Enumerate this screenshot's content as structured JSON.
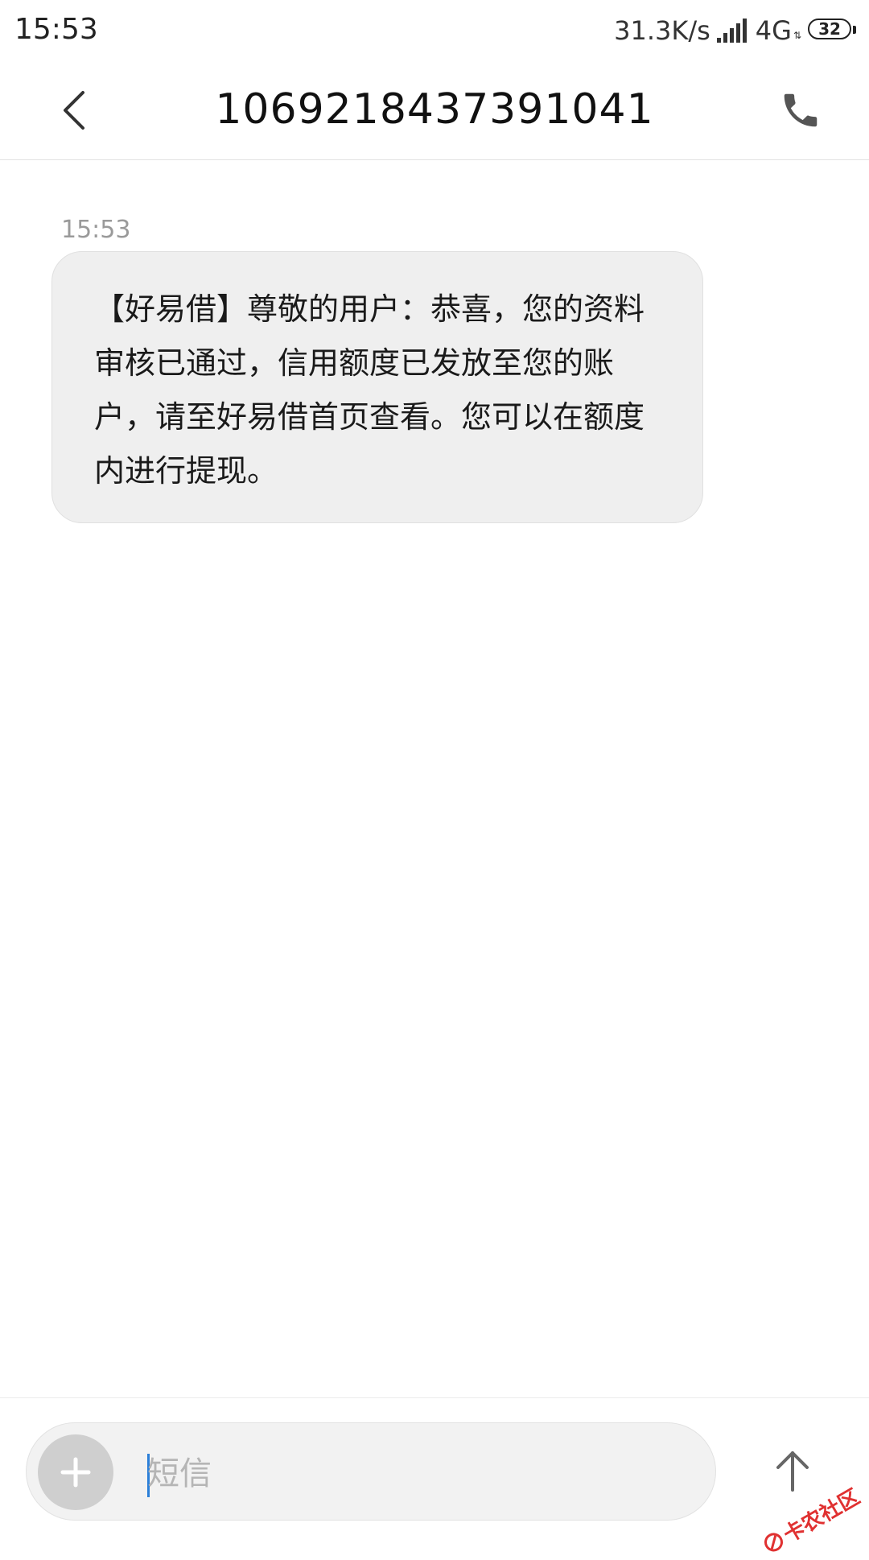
{
  "status_bar": {
    "time": "15:53",
    "speed": "31.3K/s",
    "network": "4G",
    "battery": "32"
  },
  "header": {
    "title": "1069218437391041",
    "back_icon": "chevron-left-icon",
    "call_icon": "phone-icon"
  },
  "conversation": {
    "messages": [
      {
        "time": "15:53",
        "text": "【好易借】尊敬的用户：恭喜，您的资料审核已通过，信用额度已发放至您的账户，请至好易借首页查看。您可以在额度内进行提现。"
      }
    ]
  },
  "composer": {
    "placeholder": "短信",
    "value": "",
    "add_icon": "plus-icon",
    "send_icon": "arrow-up-icon"
  },
  "watermark": {
    "text": "卡农社区"
  },
  "colors": {
    "bubble": "#efefef",
    "caret": "#2b7fd8",
    "watermark": "#e03131"
  }
}
